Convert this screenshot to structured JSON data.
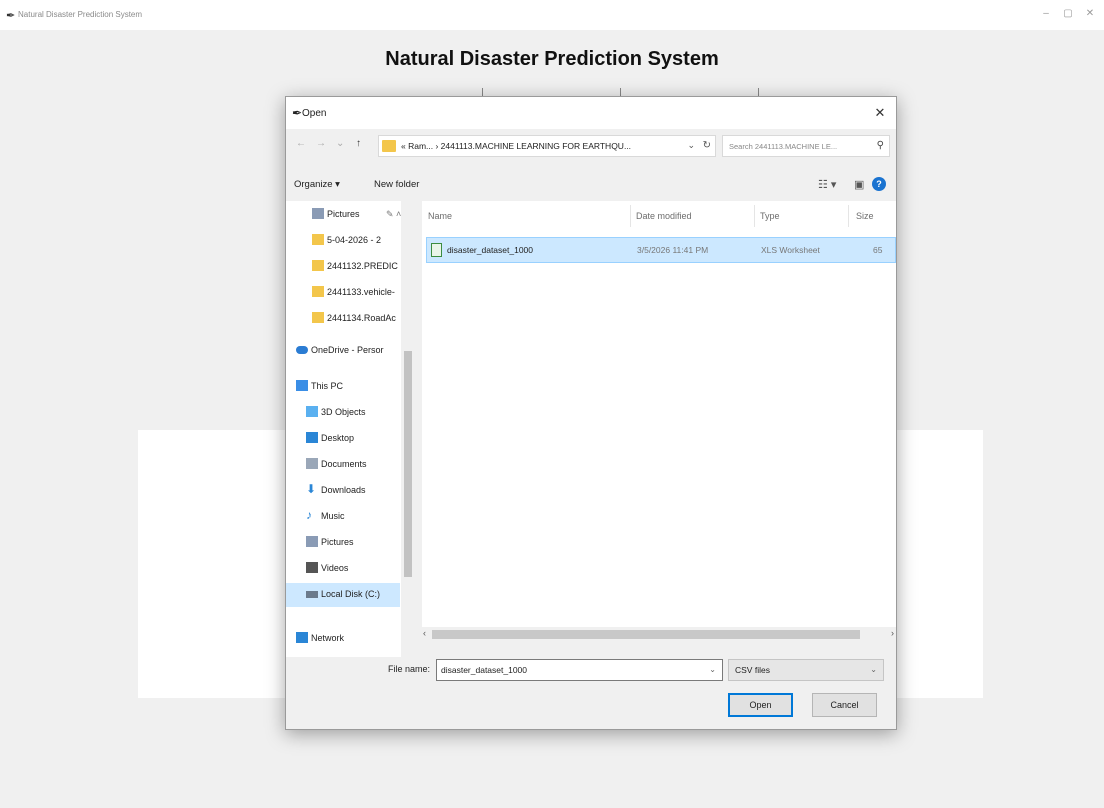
{
  "window": {
    "title": "Natural Disaster Prediction System",
    "heading": "Natural Disaster Prediction System",
    "controls": {
      "minimize": "–",
      "maximize": "▢",
      "close": "✕"
    }
  },
  "dialog": {
    "title": "Open",
    "close_glyph": "✕",
    "address_path": "« Ram... › 2441113.MACHINE LEARNING FOR EARTHQU...",
    "search_placeholder": "Search 2441113.MACHINE LE...",
    "toolbar": {
      "organize": "Organize ▾",
      "new_folder": "New folder"
    },
    "nav_items": [
      {
        "label": "Pictures",
        "icon": "pictures-icon",
        "color": "#8a9bb5"
      },
      {
        "label": "5-04-2026 - 2",
        "icon": "folder-icon",
        "color": "#f3c64b"
      },
      {
        "label": "2441132.PREDIC",
        "icon": "folder-icon",
        "color": "#f3c64b"
      },
      {
        "label": "2441133.vehicle-",
        "icon": "folder-icon",
        "color": "#f3c64b"
      },
      {
        "label": "2441134.RoadAc",
        "icon": "folder-icon",
        "color": "#f3c64b"
      },
      {
        "label": "OneDrive - Persor",
        "icon": "onedrive-icon",
        "color": "#2b7cd3"
      },
      {
        "label": "This PC",
        "icon": "computer-icon",
        "color": "#3a8ee6"
      },
      {
        "label": "3D Objects",
        "icon": "cube-icon",
        "color": "#5ab0f0"
      },
      {
        "label": "Desktop",
        "icon": "desktop-icon",
        "color": "#2a86d6"
      },
      {
        "label": "Documents",
        "icon": "documents-icon",
        "color": "#9aa7b8"
      },
      {
        "label": "Downloads",
        "icon": "download-icon",
        "color": "#2a86d6"
      },
      {
        "label": "Music",
        "icon": "music-icon",
        "color": "#2a86d6"
      },
      {
        "label": "Pictures",
        "icon": "pictures-icon",
        "color": "#8a9bb5"
      },
      {
        "label": "Videos",
        "icon": "videos-icon",
        "color": "#555555"
      },
      {
        "label": "Local Disk (C:)",
        "icon": "drive-icon",
        "color": "#6b7a8c"
      },
      {
        "label": "Network",
        "icon": "network-icon",
        "color": "#2a86d6"
      }
    ],
    "columns": {
      "name": "Name",
      "date": "Date modified",
      "type": "Type",
      "size": "Size"
    },
    "files": [
      {
        "name": "disaster_dataset_1000",
        "date": "3/5/2026 11:41 PM",
        "type": "XLS Worksheet",
        "size": "65"
      }
    ],
    "file_name_label": "File name:",
    "file_name_value": "disaster_dataset_1000",
    "filter_value": "CSV files",
    "open_label": "Open",
    "cancel_label": "Cancel"
  }
}
